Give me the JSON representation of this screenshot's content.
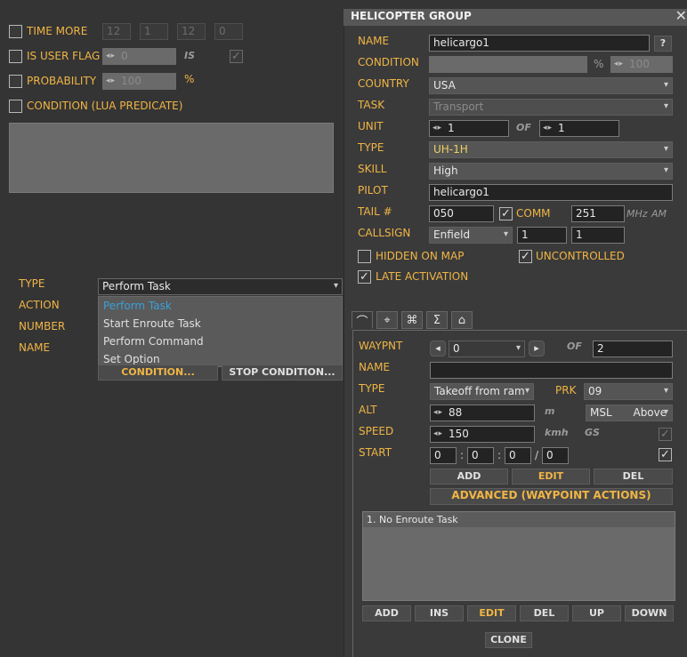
{
  "left": {
    "time_more": {
      "label": "TIME MORE",
      "v1": "12",
      "v2": "1",
      "v3": "12",
      "v4": "0"
    },
    "is_user_flag": {
      "label": "IS USER FLAG",
      "value": "0",
      "is_label": "IS"
    },
    "probability": {
      "label": "PROBABILITY",
      "value": "100",
      "unit": "%"
    },
    "condition_lua": {
      "label": "CONDITION (LUA PREDICATE)"
    },
    "action": {
      "type_label": "TYPE",
      "action_label": "ACTION",
      "number_label": "NUMBER",
      "name_label": "NAME",
      "type_value": "Perform Task",
      "menu": [
        "Perform Task",
        "Start Enroute Task",
        "Perform Command",
        "Set Option"
      ],
      "condition_button": "CONDITION...",
      "stop_condition_button": "STOP CONDITION..."
    }
  },
  "group": {
    "title": "HELICOPTER GROUP",
    "close_icon": "close-icon",
    "name_label": "NAME",
    "name_value": "helicargo1",
    "help": "?",
    "condition_label": "CONDITION",
    "condition_pct": "%",
    "condition_value": "100",
    "country_label": "COUNTRY",
    "country_value": "USA",
    "task_label": "TASK",
    "task_value": "Transport",
    "unit_label": "UNIT",
    "unit_value": "1",
    "of_label": "OF",
    "unit_of_value": "1",
    "type_label": "TYPE",
    "type_value": "UH-1H",
    "skill_label": "SKILL",
    "skill_value": "High",
    "pilot_label": "PILOT",
    "pilot_value": "helicargo1",
    "tail_label": "TAIL #",
    "tail_value": "050",
    "comm_label": "COMM",
    "comm_value": "251",
    "mhz": "MHz",
    "am": "AM",
    "callsign_label": "CALLSIGN",
    "callsign_value": "Enfield",
    "callsign_n1": "1",
    "callsign_n2": "1",
    "hidden_label": "HIDDEN ON MAP",
    "uncontrolled_label": "UNCONTROLLED",
    "late_label": "LATE ACTIVATION"
  },
  "tabs": [
    "route-icon",
    "target-icon",
    "triggers-icon",
    "summary-icon",
    "payload-icon"
  ],
  "waypoint": {
    "waypnt_label": "WAYPNT",
    "waypnt_value": "0",
    "of_label": "OF",
    "of_value": "2",
    "name_label": "NAME",
    "type_label": "TYPE",
    "type_value": "Takeoff from ram",
    "prk_label": "PRK",
    "prk_value": "09",
    "alt_label": "ALT",
    "alt_value": "88",
    "alt_unit": "m",
    "alt_ref": "MSL",
    "alt_mode": "Above",
    "speed_label": "SPEED",
    "speed_value": "150",
    "speed_unit": "kmh",
    "gs": "GS",
    "start_label": "START",
    "t1": "0",
    "t2": "0",
    "t3": "0",
    "t4": "0",
    "colon": ":",
    "slash": "/",
    "add": "ADD",
    "edit": "EDIT",
    "del": "DEL",
    "advanced": "ADVANCED (WAYPOINT ACTIONS)",
    "actions": [
      "1. No Enroute Task"
    ],
    "bottom_buttons": [
      "ADD",
      "INS",
      "EDIT",
      "DEL",
      "UP",
      "DOWN"
    ],
    "clone": "CLONE"
  },
  "colors": {
    "accent": "#f0b545",
    "highlight": "#3aa0d8",
    "bg": "#343434",
    "field": "#232323"
  }
}
